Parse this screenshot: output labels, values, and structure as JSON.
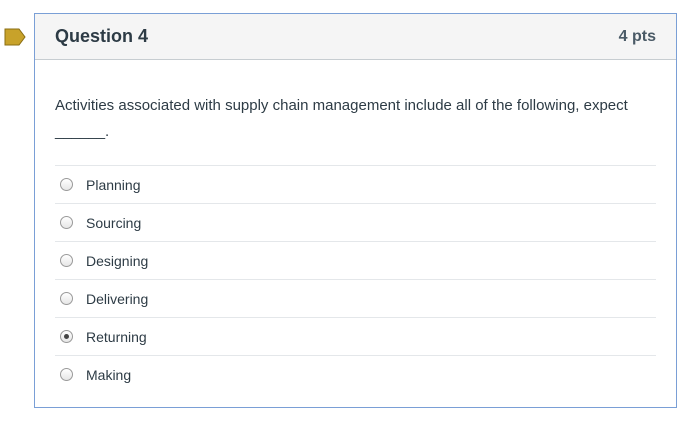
{
  "question": {
    "title": "Question 4",
    "points": "4 pts",
    "text": "Activities associated with supply chain management include all of the following, expect ______.",
    "flag_color": "#c8a22a",
    "answers": [
      {
        "label": "Planning",
        "selected": false
      },
      {
        "label": "Sourcing",
        "selected": false
      },
      {
        "label": "Designing",
        "selected": false
      },
      {
        "label": "Delivering",
        "selected": false
      },
      {
        "label": "Returning",
        "selected": true
      },
      {
        "label": "Making",
        "selected": false
      }
    ]
  }
}
